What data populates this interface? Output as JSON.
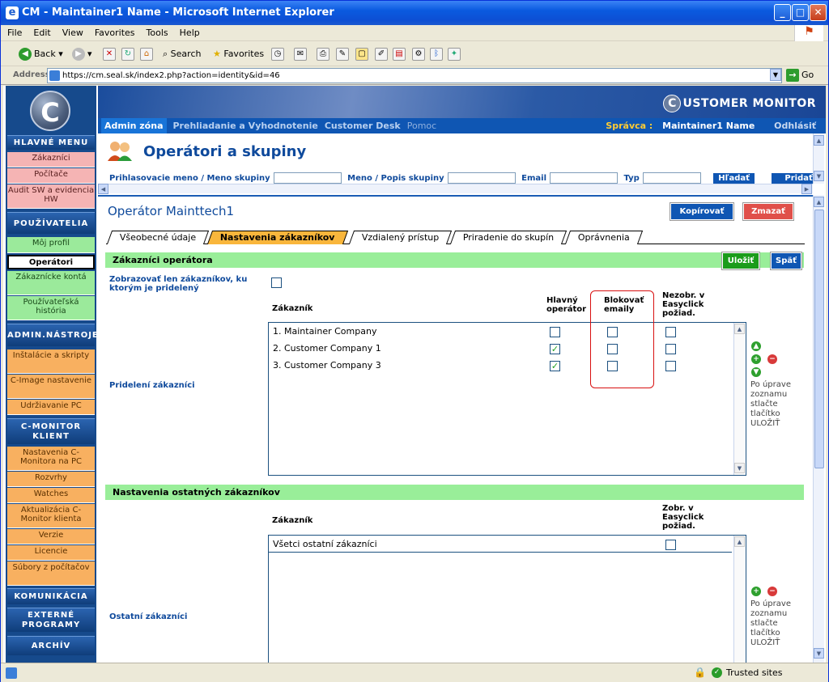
{
  "window": {
    "title": "CM - Maintainer1 Name - Microsoft Internet Explorer"
  },
  "menu": [
    "File",
    "Edit",
    "View",
    "Favorites",
    "Tools",
    "Help"
  ],
  "toolbar": {
    "back": "Back",
    "search": "Search",
    "favorites": "Favorites"
  },
  "address": {
    "label": "Address",
    "url": "https://cm.seal.sk/index2.php?action=identity&id=46",
    "go": "Go"
  },
  "status": {
    "zone": "Trusted sites"
  },
  "brand": {
    "logo_letter": "C",
    "banner": "USTOMER MONITOR"
  },
  "topnav": {
    "items": [
      "Admin zóna",
      "Prehliadanie a Vyhodnotenie",
      "Customer Desk",
      "Pomoc"
    ],
    "role_label": "Správca :",
    "user": "Maintainer1 Name",
    "logout": "Odhlásiť"
  },
  "sidebar": {
    "sections": [
      {
        "head": "HLAVNÉ MENU"
      },
      {
        "items": [
          "Zákazníci",
          "Počítače",
          "Audit SW a evidencia HW"
        ]
      },
      {
        "head": "POUŽÍVATELIA"
      },
      {
        "items": [
          "Môj profil",
          "Operátori",
          "Zákaznícke kontá",
          "Používateľská história"
        ]
      },
      {
        "head": "ADMIN.NÁSTROJE"
      },
      {
        "items": [
          "Inštalácie a skripty",
          "C-Image nastavenie",
          "Udržiavanie PC"
        ]
      },
      {
        "head": "C-MONITOR KLIENT"
      },
      {
        "items": [
          "Nastavenia C-Monitora na PC",
          "Rozvrhy",
          "Watches",
          "Aktualizácia C-Monitor klienta",
          "Verzie",
          "Licencie",
          "Súbory z počítačov"
        ]
      },
      {
        "head": "KOMUNIKÁCIA"
      },
      {
        "head": "EXTERNÉ PROGRAMY"
      },
      {
        "head": "ARCHÍV"
      }
    ]
  },
  "header": {
    "title": "Operátori a skupiny",
    "filter_login": "Prihlasovacie meno / Meno skupiny",
    "filter_name": "Meno / Popis skupiny",
    "filter_email": "Email",
    "filter_type": "Typ",
    "search_btn": "Hľadať",
    "add_btn": "Pridať operát"
  },
  "main": {
    "operator_name": "Operátor Mainttech1",
    "copy_btn": "Kopírovať",
    "delete_btn": "Zmazať",
    "tabs": [
      "Všeobecné údaje",
      "Nastavenia zákazníkov",
      "Vzdialený prístup",
      "Priradenie do skupín",
      "Oprávnenia"
    ],
    "active_tab": 1,
    "section1_title": "Zákazníci operátora",
    "save_btn": "Uložiť",
    "back_btn": "Späť",
    "show_only_label": "Zobrazovať len zákazníkov, ku ktorým je pridelený",
    "assigned_label": "Pridelení zákazníci",
    "col_customer": "Zákazník",
    "col_main_op": "Hlavný operátor",
    "col_block_email": "Blokovať emaily",
    "col_hide_easy": "Nezobr. v Easyclick požiad.",
    "customers": [
      {
        "name": "1. Maintainer Company",
        "main": false,
        "block": false,
        "hide": false
      },
      {
        "name": "2. Customer Company 1",
        "main": true,
        "block": false,
        "hide": false
      },
      {
        "name": "3. Customer Company 3",
        "main": true,
        "block": false,
        "hide": false
      }
    ],
    "hint": "Po úprave zoznamu stlačte tlačítko ULOŽIŤ",
    "section2_title": "Nastavenia ostatných zákazníkov",
    "col_customer2": "Zákazník",
    "col_show_easy": "Zobr. v Easyclick požiad.",
    "other_row": "Všetci ostatní zákazníci",
    "other_label": "Ostatní zákazníci",
    "hint2": "Po úprave zoznamu stlačte tlačítko ULOŽIŤ"
  },
  "colors": {
    "accent": "#0f56b3",
    "section_bg": "#99ee99",
    "active_tab": "#f9b63c",
    "delete": "#e0504a",
    "save": "#1a9c1a"
  }
}
